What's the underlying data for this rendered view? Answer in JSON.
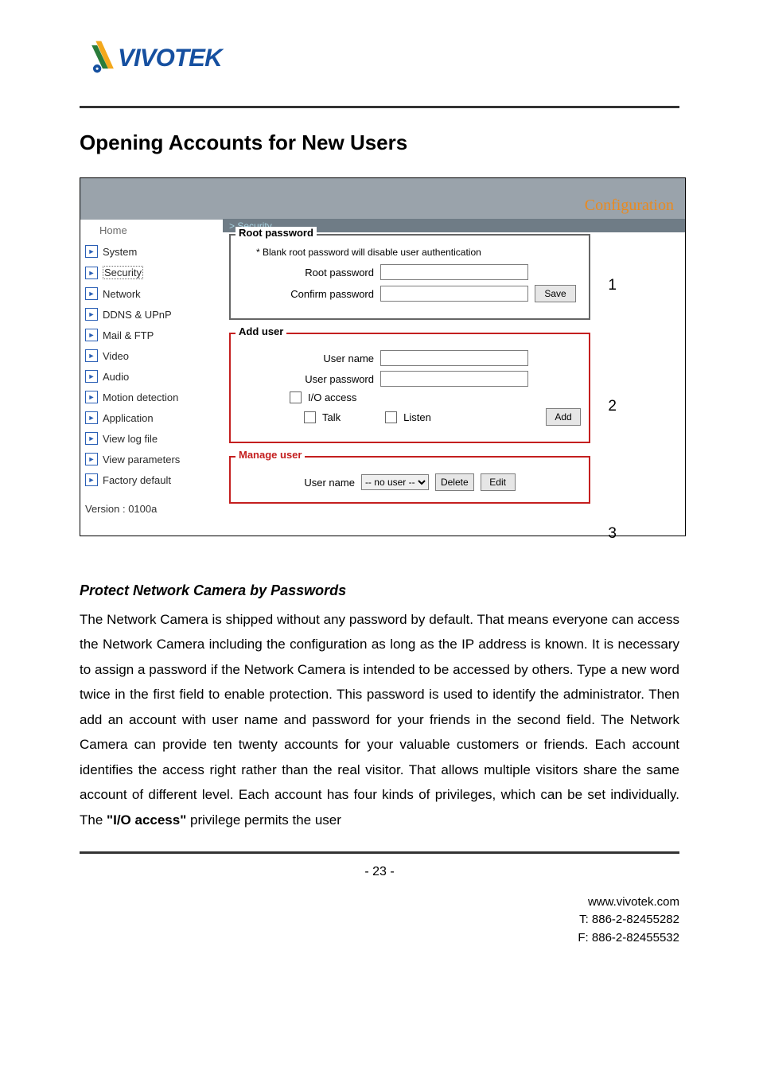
{
  "logo": {
    "text": "VIVOTEK"
  },
  "heading": "Opening Accounts for New Users",
  "shot": {
    "config_label": "Configuration",
    "breadcrumb": "> Security",
    "sidebar": {
      "home": "Home",
      "items": [
        {
          "label": "System"
        },
        {
          "label": "Security",
          "selected": true
        },
        {
          "label": "Network"
        },
        {
          "label": "DDNS & UPnP"
        },
        {
          "label": "Mail & FTP"
        },
        {
          "label": "Video"
        },
        {
          "label": "Audio"
        },
        {
          "label": "Motion detection"
        },
        {
          "label": "Application"
        },
        {
          "label": "View log file"
        },
        {
          "label": "View parameters"
        },
        {
          "label": "Factory default"
        }
      ],
      "version": "Version : 0100a"
    },
    "panels": {
      "root": {
        "legend": "Root password",
        "note": "* Blank root password will disable user authentication",
        "rows": {
          "pw_label": "Root password",
          "confirm_label": "Confirm password",
          "save": "Save"
        }
      },
      "add": {
        "legend": "Add user",
        "rows": {
          "user_label": "User name",
          "pw_label": "User password",
          "io": "I/O access",
          "talk": "Talk",
          "listen": "Listen",
          "add": "Add"
        }
      },
      "manage": {
        "legend": "Manage user",
        "rows": {
          "user_label": "User name",
          "select": "-- no user --",
          "delete": "Delete",
          "edit": "Edit"
        }
      }
    },
    "callouts": {
      "c1": "1",
      "c2": "2",
      "c3": "3"
    }
  },
  "subheading": "Protect Network Camera by Passwords",
  "body": {
    "p1a": "The Network Camera is shipped without any password by default. That means everyone can access the Network Camera including the configuration as long as the IP address is known. It is necessary to assign a password if the Network Camera is intended to be accessed by others. Type a new word twice in the first field to enable protection. This password is used to identify the administrator. Then add an account with user name and password for your friends in the second field. The Network Camera can provide ten twenty accounts for your valuable customers or friends. Each account identifies the access right rather than the real visitor. That allows multiple visitors share the same account of different level. Each account has four kinds of privileges, which can be set individually. The ",
    "io": "\"I/O access\"",
    "p1b": " privilege permits the user"
  },
  "page_number": "- 23 -",
  "contact": {
    "site": "www.vivotek.com",
    "tel": "T: 886-2-82455282",
    "fax": "F: 886-2-82455532"
  }
}
